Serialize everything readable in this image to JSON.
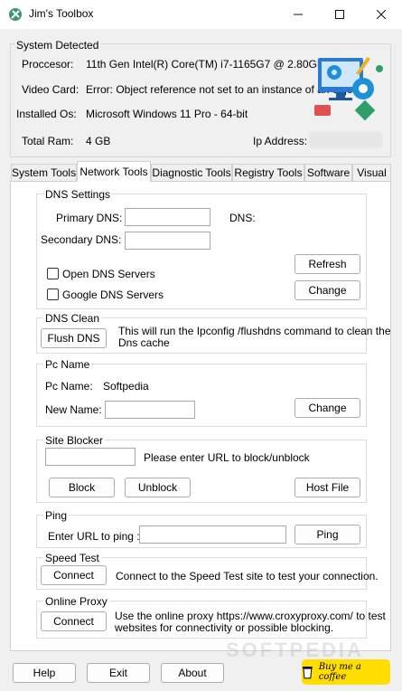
{
  "window": {
    "title": "Jim's Toolbox",
    "minimize_icon": "minimize-icon",
    "maximize_icon": "maximize-icon",
    "close_icon": "close-icon"
  },
  "system": {
    "legend": "System Detected",
    "processor_label": "Proccesor:",
    "processor_value": "11th Gen Intel(R) Core(TM) i7-1165G7 @ 2.80GHz",
    "video_label": "Video Card:",
    "video_value": "Error: Object reference not set to an instance of an object.",
    "os_label": "Installed Os:",
    "os_value": "Microsoft Windows 11 Pro - 64-bit",
    "ram_label": "Total Ram:",
    "ram_value": "4 GB",
    "ip_label": "Ip Address:"
  },
  "tabs": [
    "System Tools",
    "Network Tools",
    "Diagnostic Tools",
    "Registry Tools",
    "Software",
    "Visual"
  ],
  "active_tab": "Network Tools",
  "dns_settings": {
    "legend": "DNS Settings",
    "primary_label": "Primary DNS:",
    "dns_label": "DNS:",
    "secondary_label": "Secondary DNS:",
    "open_dns": "Open DNS Servers",
    "google_dns": "Google DNS Servers",
    "refresh": "Refresh",
    "change": "Change"
  },
  "dns_clean": {
    "legend": "DNS Clean",
    "button": "Flush DNS",
    "desc1": "This will run the Ipconfig /flushdns command to clean the",
    "desc2": "Dns cache"
  },
  "pc_name": {
    "legend": "Pc Name",
    "pc_label": "Pc Name:",
    "pc_value": "Softpedia",
    "new_label": "New Name:",
    "change": "Change"
  },
  "site_blocker": {
    "legend": "Site Blocker",
    "hint": "Please enter URL to block/unblock",
    "block": "Block",
    "unblock": "Unblock",
    "host_file": "Host File"
  },
  "ping": {
    "legend": "Ping",
    "label": "Enter URL to ping :",
    "button": "Ping"
  },
  "speed_test": {
    "legend": "Speed Test",
    "button": "Connect",
    "desc": "Connect to the Speed Test site to test your connection."
  },
  "online_proxy": {
    "legend": "Online Proxy",
    "button": "Connect",
    "desc1": "Use the online proxy https://www.croxyproxy.com/ to test",
    "desc2": "websites for connectivity or possible blocking."
  },
  "footer": {
    "help": "Help",
    "exit": "Exit",
    "about": "About",
    "coffee": "Buy me a coffee"
  },
  "watermark": "SOFTPEDIA",
  "colors": {
    "accent": "#0078d4",
    "coffee": "#ffdd00",
    "gear": "#1f8fd6",
    "monitor": "#2a7bd0",
    "wrench": "#f2b01e"
  }
}
